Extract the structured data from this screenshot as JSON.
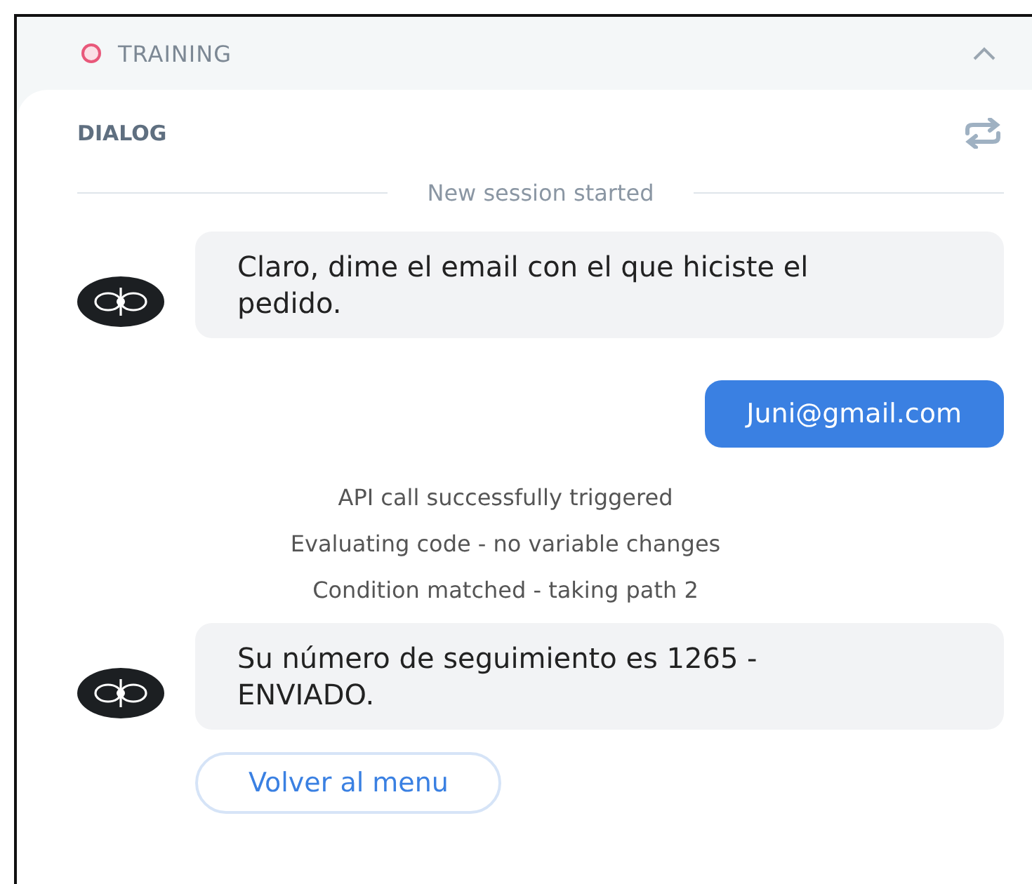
{
  "header": {
    "title": "TRAINING",
    "expanded": true
  },
  "dialog": {
    "title": "DIALOG",
    "separator": "New session started",
    "messages": [
      {
        "kind": "bot",
        "text": "Claro, dime el email con el que hiciste el pedido."
      },
      {
        "kind": "user",
        "text": "Juni@gmail.com"
      },
      {
        "kind": "system",
        "text": "API call successfully triggered"
      },
      {
        "kind": "system",
        "text": "Evaluating code - no variable changes"
      },
      {
        "kind": "system",
        "text": "Condition matched - taking path 2"
      },
      {
        "kind": "bot",
        "text": "Su número de seguimiento es 1265 - ENVIADO."
      },
      {
        "kind": "button",
        "text": "Volver al menu"
      }
    ]
  }
}
